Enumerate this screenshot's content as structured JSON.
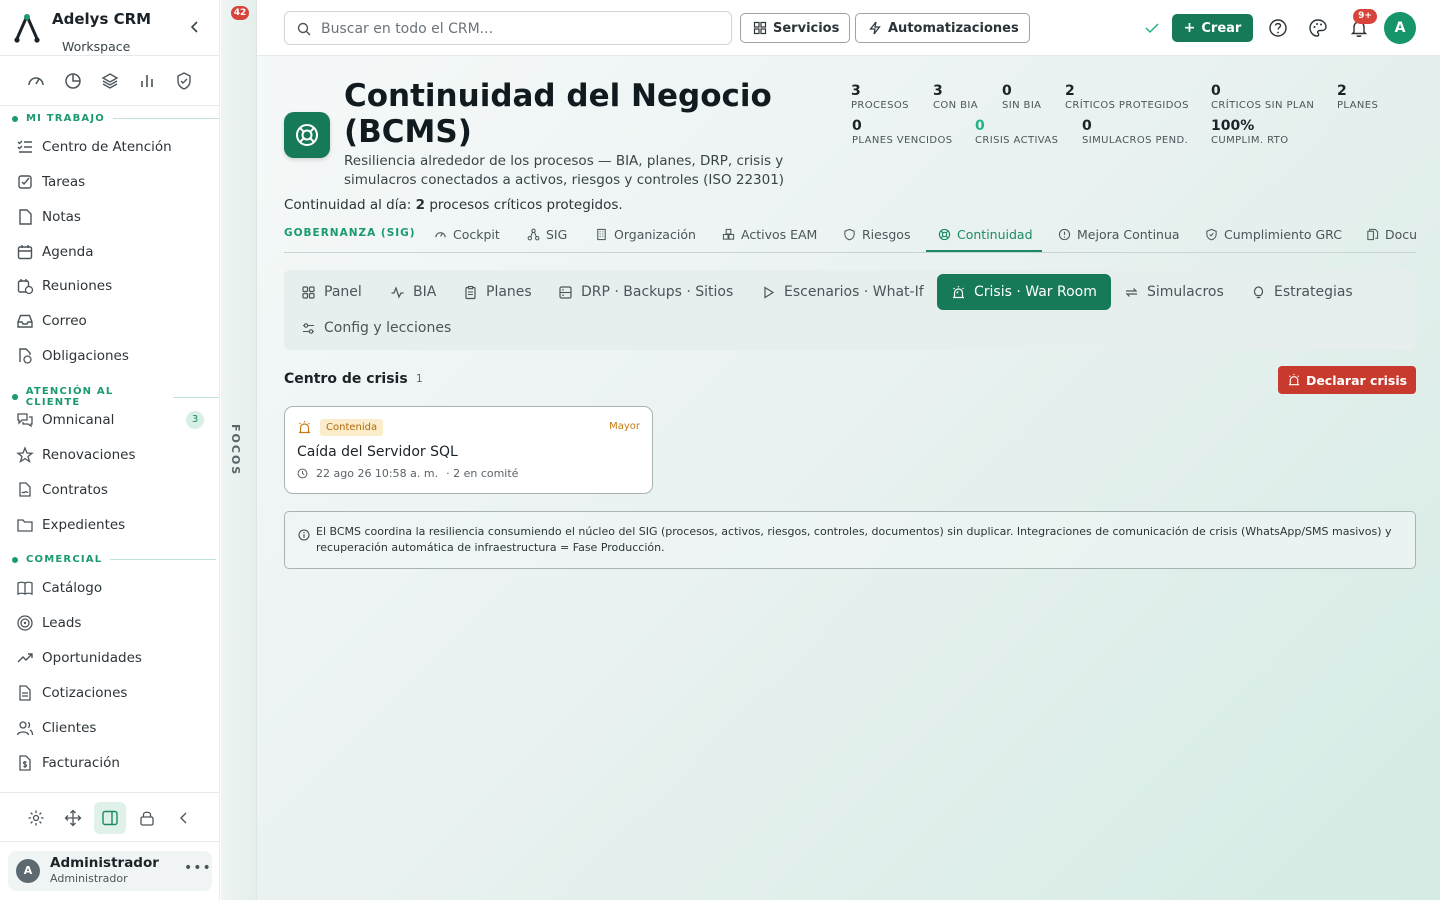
{
  "app": {
    "name": "Adelys CRM",
    "workspace": "Workspace"
  },
  "sidebar": {
    "sections": [
      {
        "title": "MI TRABAJO",
        "items": [
          {
            "label": "Centro de Atención",
            "icon": "list-check-icon"
          },
          {
            "label": "Tareas",
            "icon": "checkbox-icon"
          },
          {
            "label": "Notas",
            "icon": "note-icon"
          },
          {
            "label": "Agenda",
            "icon": "calendar-icon"
          },
          {
            "label": "Reuniones",
            "icon": "calendar-clock-icon"
          },
          {
            "label": "Correo",
            "icon": "inbox-icon"
          },
          {
            "label": "Obligaciones",
            "icon": "file-clock-icon"
          }
        ]
      },
      {
        "title": "ATENCIÓN AL CLIENTE",
        "items": [
          {
            "label": "Omnicanal",
            "icon": "chat-icon",
            "badge": "3"
          },
          {
            "label": "Renovaciones",
            "icon": "star-icon"
          },
          {
            "label": "Contratos",
            "icon": "file-signature-icon"
          },
          {
            "label": "Expedientes",
            "icon": "folder-icon"
          }
        ]
      },
      {
        "title": "COMERCIAL",
        "items": [
          {
            "label": "Catálogo",
            "icon": "book-icon"
          },
          {
            "label": "Leads",
            "icon": "target-icon"
          },
          {
            "label": "Oportunidades",
            "icon": "trend-icon"
          },
          {
            "label": "Cotizaciones",
            "icon": "document-icon"
          },
          {
            "label": "Clientes",
            "icon": "users-icon"
          },
          {
            "label": "Facturación",
            "icon": "invoice-icon"
          }
        ]
      }
    ]
  },
  "user": {
    "name": "Administrador",
    "role": "Administrador",
    "initial": "A"
  },
  "focos": {
    "label": "FOCOS",
    "count": "42"
  },
  "topbar": {
    "search_placeholder": "Buscar en todo el CRM...",
    "servicios": "Servicios",
    "automatizaciones": "Automatizaciones",
    "crear": "Crear",
    "notif_badge": "9+",
    "avatar": "A"
  },
  "hero": {
    "title": "Continuidad del Negocio (BCMS)",
    "description": "Resiliencia alrededor de los procesos — BIA, planes, DRP, crisis y simulacros conectados a activos, riesgos y controles (ISO 22301)",
    "sub_prefix": "Continuidad al día:",
    "sub_count": "2",
    "sub_suffix": "procesos críticos protegidos."
  },
  "stats": [
    {
      "value": "3",
      "label": "PROCESOS"
    },
    {
      "value": "3",
      "label": "CON BIA"
    },
    {
      "value": "0",
      "label": "SIN BIA"
    },
    {
      "value": "2",
      "label": "CRÍTICOS PROTEGIDOS"
    },
    {
      "value": "0",
      "label": "CRÍTICOS SIN PLAN"
    },
    {
      "value": "2",
      "label": "PLANES"
    },
    {
      "value": "0",
      "label": "PLANES VENCIDOS"
    },
    {
      "value": "0",
      "label": "CRISIS ACTIVAS"
    },
    {
      "value": "0",
      "label": "SIMULACROS PEND."
    },
    {
      "value": "100%",
      "label": "CUMPLIM. RTO"
    }
  ],
  "tabs": {
    "group": "GOBERNANZA (SIG)",
    "items": [
      "Cockpit",
      "SIG",
      "Organización",
      "Activos EAM",
      "Riesgos",
      "Continuidad",
      "Mejora Continua",
      "Cumplimiento GRC",
      "Docu"
    ]
  },
  "subnav": [
    "Panel",
    "BIA",
    "Planes",
    "DRP · Backups · Sitios",
    "Escenarios · What-If",
    "Crisis · War Room",
    "Simulacros",
    "Estrategias",
    "Config y lecciones"
  ],
  "crisis": {
    "title": "Centro de crisis",
    "count": "1",
    "declare": "Declarar crisis",
    "card": {
      "status": "Contenida",
      "severity": "Mayor",
      "title": "Caída del Servidor SQL",
      "date": "22 ago 26 10:58 a. m.",
      "committee": "· 2 en comité"
    }
  },
  "info": "El BCMS coordina la resiliencia consumiendo el núcleo del SIG (procesos, activos, riesgos, controles, documentos) sin duplicar. Integraciones de comunicación de crisis (WhatsApp/SMS masivos) y recuperación automática de infraestructura = Fase Producción.",
  "colors": {
    "accent": "#167a58",
    "danger": "#c8392e",
    "warning": "#c77a12"
  }
}
